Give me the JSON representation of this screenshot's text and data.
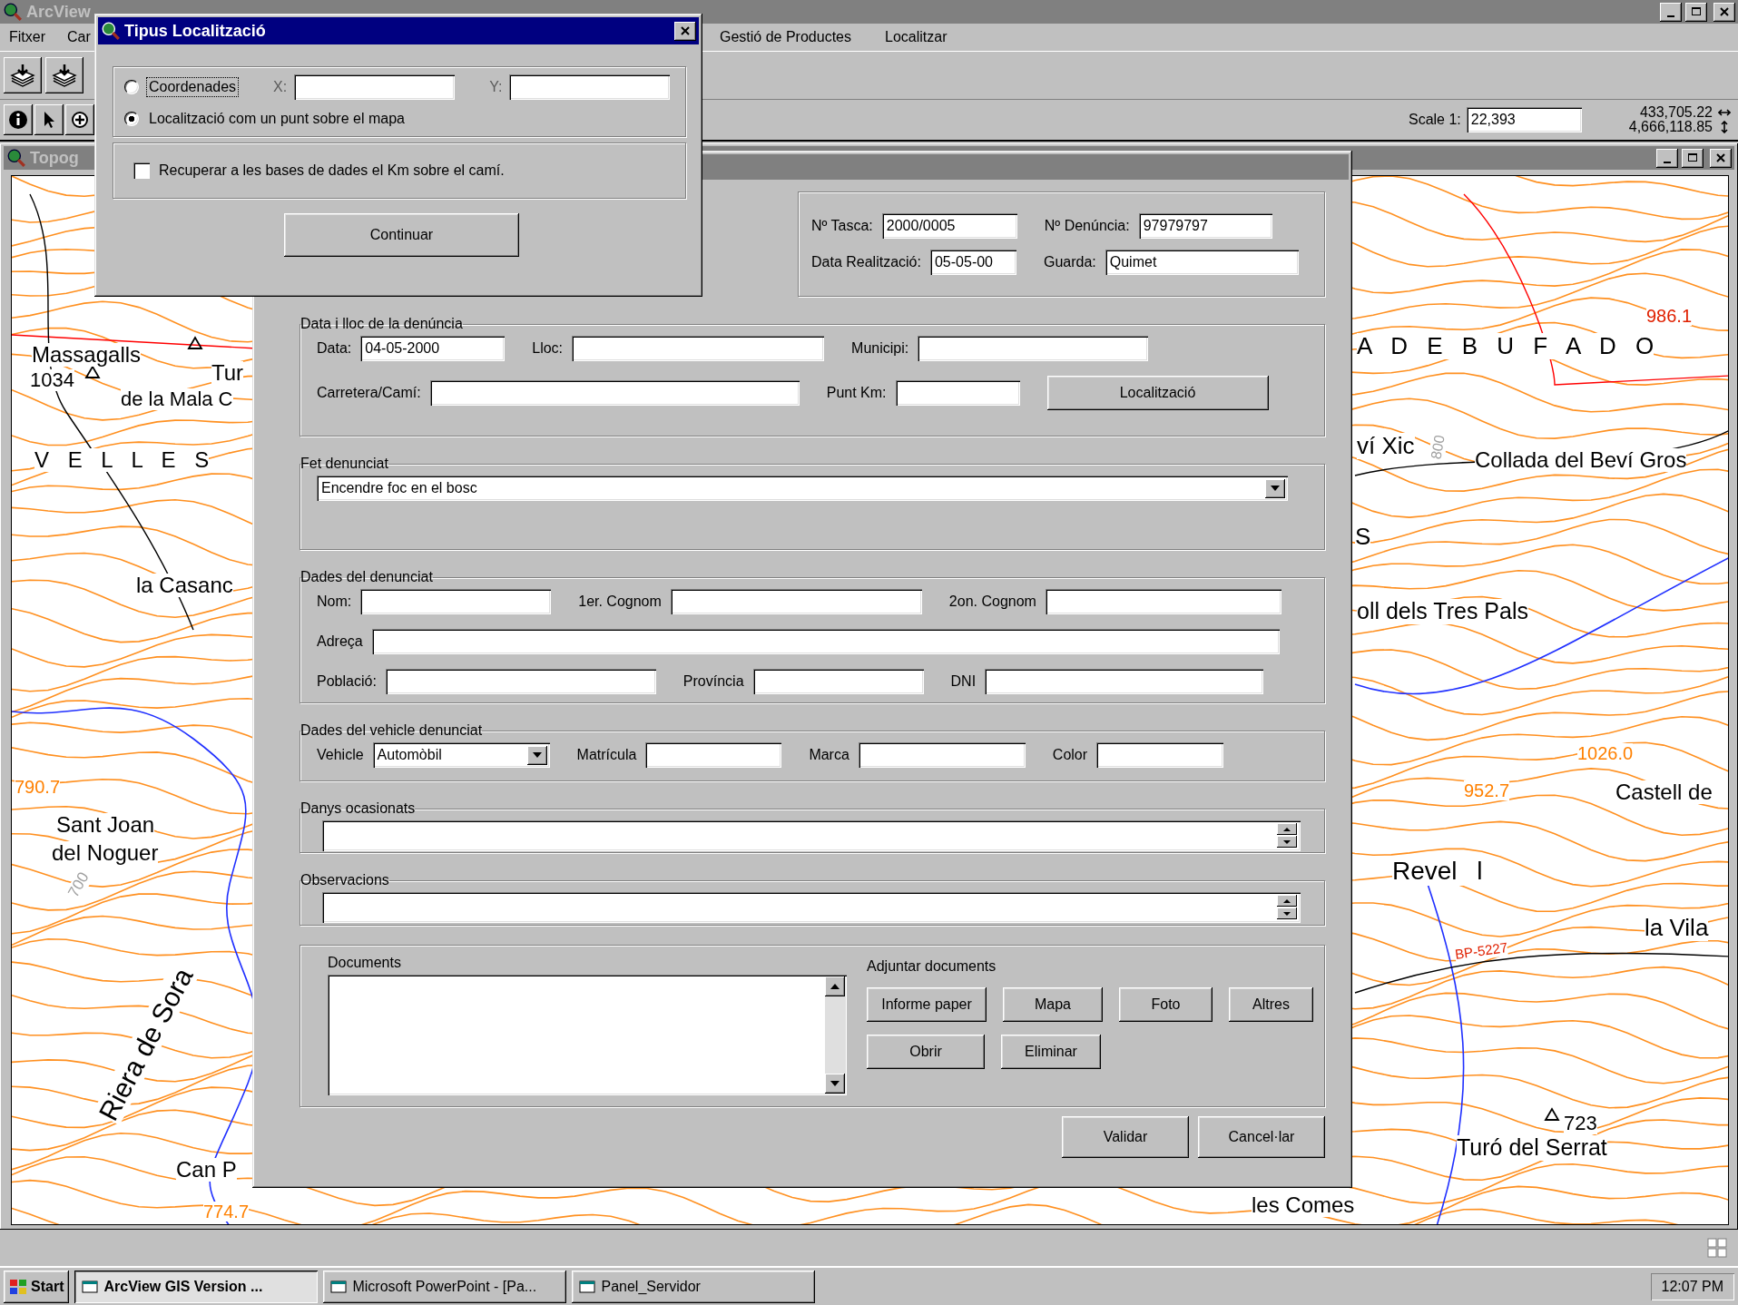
{
  "main_window": {
    "title": "ArcView",
    "menu": [
      {
        "label": "Fitxer"
      },
      {
        "label": "Car"
      },
      {
        "label": "Gestió de Productes"
      },
      {
        "label": "Localitzar"
      }
    ],
    "scale_label": "Scale 1:",
    "scale": "22,393",
    "x_coord": "433,705.22",
    "y_coord": "4,666,118.85"
  },
  "map_window": {
    "title": "Topog",
    "labels": [
      {
        "text": "Massagalls",
        "kind": "place"
      },
      {
        "text": "1034",
        "kind": "place"
      },
      {
        "text": "Tur",
        "kind": "place"
      },
      {
        "text": "de la Mala C",
        "kind": "place"
      },
      {
        "text": "V E L L E S",
        "kind": "area"
      },
      {
        "text": "la Casanc",
        "kind": "place"
      },
      {
        "text": "790.7",
        "kind": "elevation"
      },
      {
        "text": "Sant Joan",
        "kind": "place"
      },
      {
        "text": "del Noguer",
        "kind": "place"
      },
      {
        "text": "700",
        "kind": "contour"
      },
      {
        "text": "Riera de Sora",
        "kind": "place"
      },
      {
        "text": "Can P",
        "kind": "place"
      },
      {
        "text": "774.7",
        "kind": "elevation"
      },
      {
        "text": "986.1",
        "kind": "road"
      },
      {
        "text": "A D E B U F A D O",
        "kind": "area"
      },
      {
        "text": "ví Xic",
        "kind": "place"
      },
      {
        "text": "800",
        "kind": "contour"
      },
      {
        "text": "Collada del Beví Gros",
        "kind": "place"
      },
      {
        "text": "S",
        "kind": "place"
      },
      {
        "text": "oll dels Tres Pals",
        "kind": "place"
      },
      {
        "text": "1026.0",
        "kind": "elevation"
      },
      {
        "text": "952.7",
        "kind": "elevation"
      },
      {
        "text": "Castell de",
        "kind": "place"
      },
      {
        "text": "Revel l",
        "kind": "area"
      },
      {
        "text": "la Vila",
        "kind": "place"
      },
      {
        "text": "BP-5227",
        "kind": "road"
      },
      {
        "text": "723",
        "kind": "place"
      },
      {
        "text": "Turó del Serrat",
        "kind": "place"
      },
      {
        "text": "les Comes",
        "kind": "place"
      }
    ]
  },
  "form": {
    "header": [
      {
        "label": "Nº Tasca:",
        "value": "2000/0005"
      },
      {
        "label": "Nº Denúncia:",
        "value": "97979797"
      },
      {
        "label": "Data Realització:",
        "value": "05-05-00"
      },
      {
        "label": "Guarda:",
        "value": "Quimet"
      }
    ],
    "groups": [
      {
        "kind": "fields",
        "title": "Data i lloc de la denúncia",
        "rows": [
          [
            {
              "kind": "text",
              "label": "Data:",
              "value": "04-05-2000"
            },
            {
              "kind": "text",
              "label": "Lloc:"
            },
            {
              "kind": "text",
              "label": "Municipi:"
            }
          ],
          [
            {
              "kind": "text",
              "label": "Carretera/Camí:"
            },
            {
              "kind": "text",
              "label": "Punt Km:"
            },
            {
              "kind": "button",
              "label": "Localització"
            }
          ]
        ]
      },
      {
        "kind": "fields",
        "title": "Fet denunciat",
        "rows": [
          [
            {
              "kind": "select",
              "value": "Encendre foc en el bosc"
            }
          ]
        ]
      },
      {
        "kind": "fields",
        "title": "Dades del denunciat",
        "rows": [
          [
            {
              "kind": "text",
              "label": "Nom:"
            },
            {
              "kind": "text",
              "label": "1er. Cognom"
            },
            {
              "kind": "text",
              "label": "2on. Cognom"
            }
          ],
          [
            {
              "kind": "text",
              "label": "Adreça"
            }
          ],
          [
            {
              "kind": "text",
              "label": "Població:"
            },
            {
              "kind": "text",
              "label": "Província"
            },
            {
              "kind": "text",
              "label": "DNI"
            }
          ]
        ]
      },
      {
        "kind": "fields",
        "title": "Dades del vehicle denunciat",
        "rows": [
          [
            {
              "kind": "select",
              "label": "Vehicle",
              "value": "Automòbil"
            },
            {
              "kind": "text",
              "label": "Matrícula"
            },
            {
              "kind": "text",
              "label": "Marca"
            },
            {
              "kind": "text",
              "label": "Color"
            }
          ]
        ]
      },
      {
        "kind": "memo",
        "title": "Danys ocasionats"
      },
      {
        "kind": "memo",
        "title": "Observacions"
      },
      {
        "kind": "documents",
        "title": "Documents",
        "attach_label": "Adjuntar documents",
        "attach_buttons": [
          "Informe paper",
          "Mapa",
          "Foto",
          "Altres"
        ],
        "list_buttons": [
          "Obrir",
          "Eliminar"
        ]
      }
    ],
    "buttons": [
      "Validar",
      "Cancel·lar"
    ]
  },
  "locate_dialog": {
    "title": "Tipus Localització",
    "options": [
      {
        "label": "Coordenades",
        "selected": false,
        "focused": true
      },
      {
        "label": "Localització com un punt sobre el mapa",
        "selected": true,
        "focused": false
      }
    ],
    "x_label": "X:",
    "y_label": "Y:",
    "coords_disabled": true,
    "checkbox": {
      "label": "Recuperar a les bases de dades el Km sobre el camí.",
      "checked": false
    },
    "button": "Continuar"
  },
  "taskbar": {
    "start": "Start",
    "tasks": [
      {
        "label": "ArcView GIS Version ...",
        "selected": true
      },
      {
        "label": "Microsoft PowerPoint - [Pa...",
        "selected": false
      },
      {
        "label": "Panel_Servidor",
        "selected": false
      }
    ],
    "clock": "12:07 PM"
  }
}
